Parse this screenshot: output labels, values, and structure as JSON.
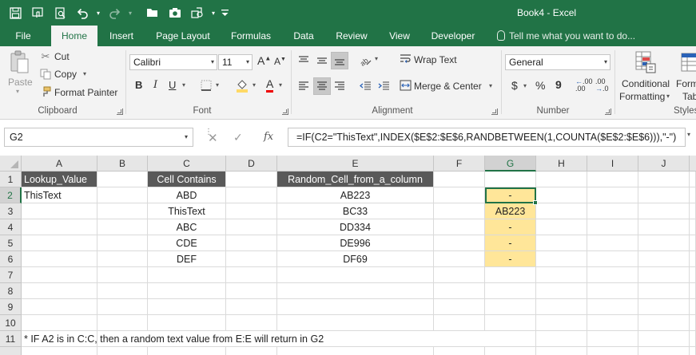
{
  "app": {
    "title": "Book4 - Excel"
  },
  "quick_access": {
    "icons": [
      "save-icon",
      "touch-mode-icon",
      "print-preview-icon",
      "undo-icon",
      "redo-icon",
      "open-icon",
      "camera-icon",
      "shapes-icon",
      "customize-icon"
    ]
  },
  "tabs": [
    {
      "label": "File",
      "active": false
    },
    {
      "label": "Home",
      "active": true
    },
    {
      "label": "Insert",
      "active": false
    },
    {
      "label": "Page Layout",
      "active": false
    },
    {
      "label": "Formulas",
      "active": false
    },
    {
      "label": "Data",
      "active": false
    },
    {
      "label": "Review",
      "active": false
    },
    {
      "label": "View",
      "active": false
    },
    {
      "label": "Developer",
      "active": false
    }
  ],
  "tell_me": "Tell me what you want to do...",
  "clipboard": {
    "paste": "Paste",
    "cut": "Cut",
    "copy": "Copy",
    "format_painter": "Format Painter",
    "label": "Clipboard"
  },
  "font": {
    "name": "Calibri",
    "size": "11",
    "bold": "B",
    "italic": "I",
    "underline": "U",
    "grow": "A",
    "shrink": "A",
    "color_letter": "A",
    "label": "Font"
  },
  "alignment": {
    "wrap_text": "Wrap Text",
    "merge_center": "Merge & Center",
    "label": "Alignment"
  },
  "number": {
    "format": "General",
    "currency": "$",
    "percent": "%",
    "comma": "9",
    "inc_decimal": ".00",
    "dec_decimal": ".00",
    "label": "Number"
  },
  "styles": {
    "conditional_formatting_1": "Conditional",
    "conditional_formatting_2": "Formatting",
    "format_as_table_1": "Form",
    "format_as_table_2": "Tab",
    "label": "Styles"
  },
  "formula_bar": {
    "name_box": "G2",
    "formula": "=IF(C2=\"ThisText\",INDEX($E$2:$E$6,RANDBETWEEN(1,COUNTA($E$2:$E$6))),\"-\")"
  },
  "columns": [
    "A",
    "B",
    "C",
    "D",
    "E",
    "F",
    "G",
    "H",
    "I",
    "J"
  ],
  "rows": [
    "1",
    "2",
    "3",
    "4",
    "5",
    "6",
    "7",
    "8",
    "9",
    "10",
    "11"
  ],
  "cells": {
    "A1": "Lookup_Value",
    "C1": "Cell Contains",
    "E1": "Random_Cell_from_a_column",
    "A2": "ThisText",
    "C2": "ABD",
    "C3": "ThisText",
    "C4": "ABC",
    "C5": "CDE",
    "C6": "DEF",
    "E2": "AB223",
    "E3": "BC33",
    "E4": "DD334",
    "E5": "DE996",
    "E6": "DF69",
    "G2": "-",
    "G3": "AB223",
    "G4": "-",
    "G5": "-",
    "G6": "-",
    "A11": "* IF A2 is in C:C, then a random text value from E:E will return in G2"
  },
  "colors": {
    "accent": "#217346",
    "header_fill": "#595959",
    "highlight_fill": "#ffe699"
  }
}
